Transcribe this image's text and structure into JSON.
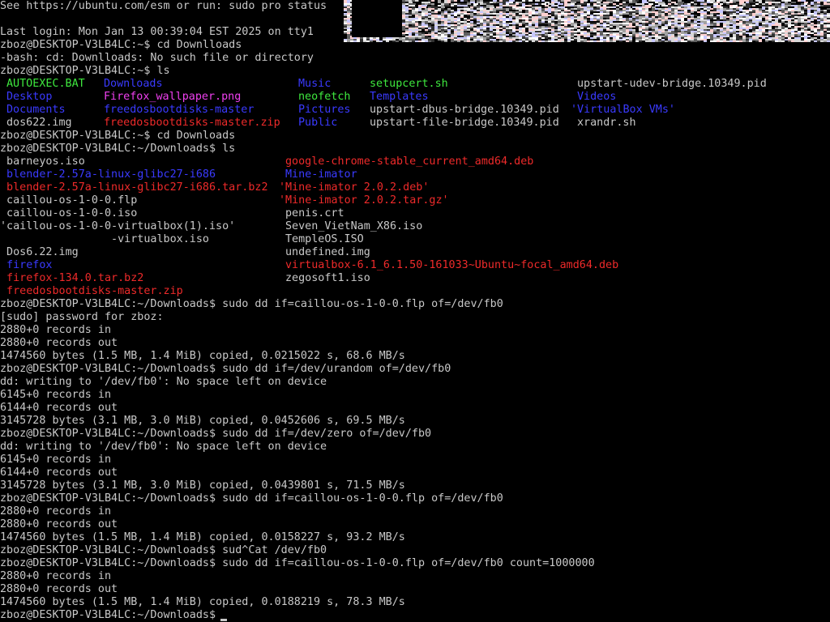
{
  "terminal": {
    "lines": [
      "See https://ubuntu.com/esm or run: sudo pro status",
      "",
      "Last login: Mon Jan 13 00:39:04 EST 2025 on tty1",
      "zboz@DESKTOP-V3LB4LC:~$ cd Downlloads",
      "-bash: cd: Downlloads: No such file or directory",
      "zboz@DESKTOP-V3LB4LC:~$ ls"
    ],
    "home_listing": [
      [
        {
          "text": "AUTOEXEC.BAT",
          "color": "green"
        },
        {
          "text": "Downloads",
          "color": "blue"
        },
        {
          "text": "Music",
          "color": "blue"
        },
        {
          "text": "setupcert.sh",
          "color": "green"
        },
        {
          "text": "upstart-udev-bridge.10349.pid",
          "color": "default"
        }
      ],
      [
        {
          "text": "Desktop",
          "color": "blue"
        },
        {
          "text": "Firefox_wallpaper.png",
          "color": "magenta"
        },
        {
          "text": "neofetch",
          "color": "green"
        },
        {
          "text": "Templates",
          "color": "blue"
        },
        {
          "text": "Videos",
          "color": "blue"
        }
      ],
      [
        {
          "text": "Documents",
          "color": "blue"
        },
        {
          "text": "freedosbootdisks-master",
          "color": "blue"
        },
        {
          "text": "Pictures",
          "color": "blue"
        },
        {
          "text": "upstart-dbus-bridge.10349.pid",
          "color": "default"
        },
        {
          "text": "'VirtualBox VMs'",
          "color": "blue"
        }
      ],
      [
        {
          "text": "dos622.img",
          "color": "default"
        },
        {
          "text": "freedosbootdisks-master.zip",
          "color": "red"
        },
        {
          "text": "Public",
          "color": "blue"
        },
        {
          "text": "upstart-file-bridge.10349.pid",
          "color": "default"
        },
        {
          "text": "xrandr.sh",
          "color": "default"
        }
      ]
    ],
    "cmd_cd_downloads": "zboz@DESKTOP-V3LB4LC:~$ cd Downloads",
    "cmd_ls_downloads": "zboz@DESKTOP-V3LB4LC:~/Downloads$ ls",
    "downloads_listing": [
      [
        {
          "text": " barneyos.iso",
          "color": "default"
        },
        {
          "text": "google-chrome-stable_current_amd64.deb",
          "color": "red"
        }
      ],
      [
        {
          "text": " blender-2.57a-linux-glibc27-i686",
          "color": "blue"
        },
        {
          "text": "Mine-imator",
          "color": "blue"
        }
      ],
      [
        {
          "text": " blender-2.57a-linux-glibc27-i686.tar.bz2",
          "color": "red"
        },
        {
          "text": "'Mine-imator 2.0.2.deb'",
          "color": "red"
        }
      ],
      [
        {
          "text": " caillou-os-1-0-0.flp",
          "color": "default"
        },
        {
          "text": "'Mine-imator 2.0.2.tar.gz'",
          "color": "red"
        }
      ],
      [
        {
          "text": " caillou-os-1-0-0.iso",
          "color": "default"
        },
        {
          "text": "penis.crt",
          "color": "default"
        }
      ],
      [
        {
          "text": "'caillou-os-1-0-0-virtualbox(1).iso'",
          "color": "default"
        },
        {
          "text": "Seven_VietNam_X86.iso",
          "color": "default"
        }
      ],
      [
        {
          "text": "                 -virtualbox.iso",
          "color": "default"
        },
        {
          "text": "TempleOS.ISO",
          "color": "default"
        }
      ],
      [
        {
          "text": " Dos6.22.img",
          "color": "default"
        },
        {
          "text": "undefined.img",
          "color": "default"
        }
      ],
      [
        {
          "text": " firefox",
          "color": "blue"
        },
        {
          "text": "virtualbox-6.1_6.1.50-161033~Ubuntu~focal_amd64.deb",
          "color": "red"
        }
      ],
      [
        {
          "text": " firefox-134.0.tar.bz2",
          "color": "red"
        },
        {
          "text": "zegosoft1.iso",
          "color": "default"
        }
      ],
      [
        {
          "text": " freedosbootdisks-master.zip",
          "color": "red"
        },
        {
          "text": "",
          "color": "default"
        }
      ]
    ],
    "session_lines": [
      "zboz@DESKTOP-V3LB4LC:~/Downloads$ sudo dd if=caillou-os-1-0-0.flp of=/dev/fb0",
      "[sudo] password for zboz:",
      "2880+0 records in",
      "2880+0 records out",
      "1474560 bytes (1.5 MB, 1.4 MiB) copied, 0.0215022 s, 68.6 MB/s",
      "zboz@DESKTOP-V3LB4LC:~/Downloads$ sudo dd if=/dev/urandom of=/dev/fb0",
      "dd: writing to '/dev/fb0': No space left on device",
      "6145+0 records in",
      "6144+0 records out",
      "3145728 bytes (3.1 MB, 3.0 MiB) copied, 0.0452606 s, 69.5 MB/s",
      "zboz@DESKTOP-V3LB4LC:~/Downloads$ sudo dd if=/dev/zero of=/dev/fb0",
      "dd: writing to '/dev/fb0': No space left on device",
      "6145+0 records in",
      "6144+0 records out",
      "3145728 bytes (3.1 MB, 3.0 MiB) copied, 0.0439801 s, 71.5 MB/s",
      "zboz@DESKTOP-V3LB4LC:~/Downloads$ sudo dd if=caillou-os-1-0-0.flp of=/dev/fb0",
      "2880+0 records in",
      "2880+0 records out",
      "1474560 bytes (1.5 MB, 1.4 MiB) copied, 0.0158227 s, 93.2 MB/s",
      "zboz@DESKTOP-V3LB4LC:~/Downloads$ sud^Cat /dev/fb0",
      "zboz@DESKTOP-V3LB4LC:~/Downloads$ sudo dd if=caillou-os-1-0-0.flp of=/dev/fb0 count=1000000",
      "2880+0 records in",
      "2880+0 records out",
      "1474560 bytes (1.5 MB, 1.4 MiB) copied, 0.0188219 s, 78.3 MB/s",
      "zboz@DESKTOP-V3LB4LC:~/Downloads$ "
    ]
  },
  "colors": {
    "background": "#000000",
    "default": "#c8c8c8",
    "green": "#3ee83e",
    "blue": "#3a3aff",
    "magenta": "#f040f0",
    "red": "#ee2a2a"
  }
}
